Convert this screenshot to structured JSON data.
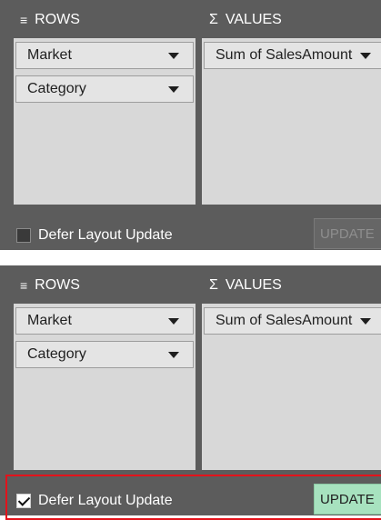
{
  "top": {
    "rows_header": "ROWS",
    "values_header": "VALUES",
    "rows_fields": [
      "Market",
      "Category"
    ],
    "values_fields": [
      "Sum of SalesAmount"
    ],
    "defer_label": "Defer Layout Update",
    "defer_checked": false,
    "update_label": "UPDATE",
    "update_enabled": false
  },
  "bottom": {
    "rows_header": "ROWS",
    "values_header": "VALUES",
    "rows_fields": [
      "Market",
      "Category"
    ],
    "values_fields": [
      "Sum of SalesAmount"
    ],
    "defer_label": "Defer Layout Update",
    "defer_checked": true,
    "update_label": "UPDATE",
    "update_enabled": true
  },
  "icons": {
    "rows": "rows-list-icon",
    "values": "sigma-icon",
    "dropdown": "chevron-down-icon"
  },
  "colors": {
    "panel_bg": "#5c5c5c",
    "area_bg": "#d8d8d8",
    "update_enabled_bg": "#a7e2bf",
    "highlight_border": "#e3121b"
  }
}
